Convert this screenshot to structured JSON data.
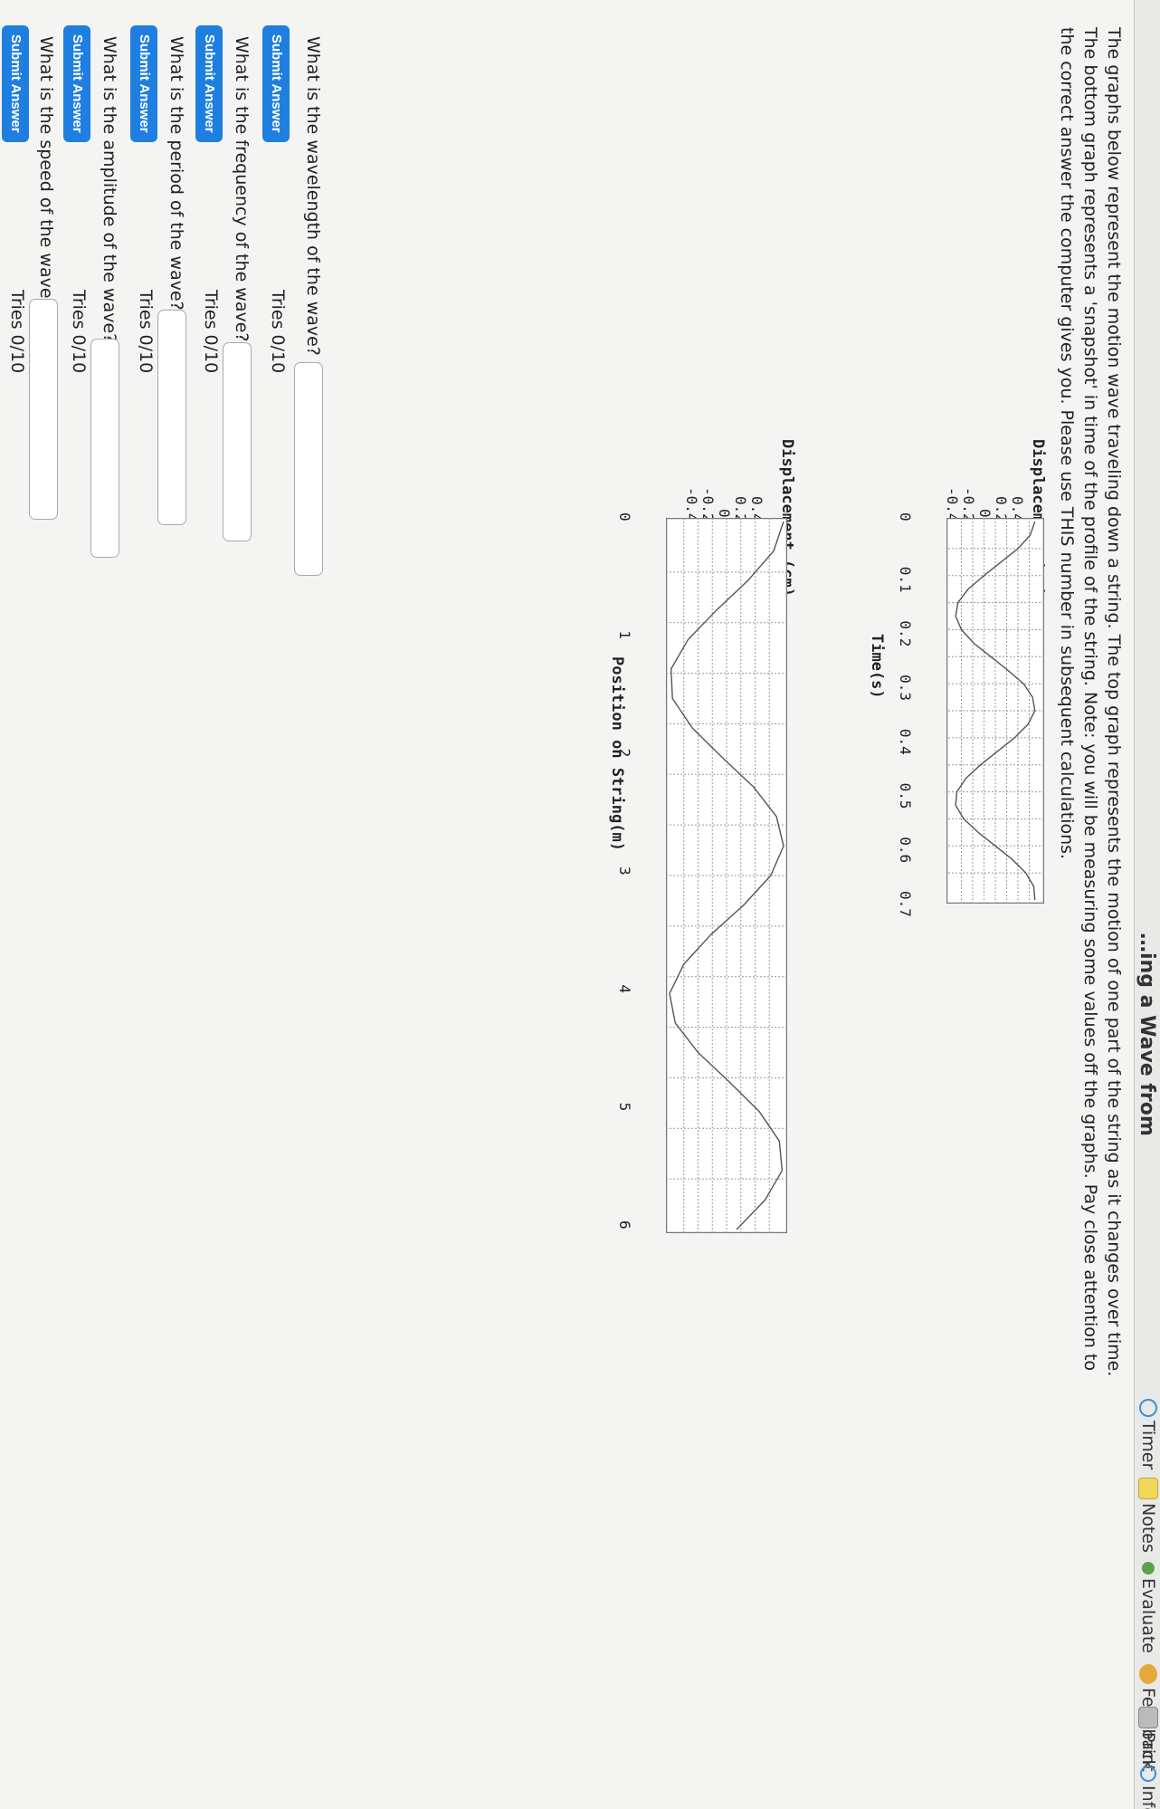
{
  "toolbar": {
    "heading": "…ing a Wave from",
    "timer": "Timer",
    "notes": "Notes",
    "evaluate": "Evaluate",
    "feedback": "Feedback",
    "print": "Print",
    "info": "Info"
  },
  "intro": {
    "line1": "The graphs below represent the motion wave traveling down a string. The top graph represents the motion of one part of the string as it changes over time.",
    "line2": "The bottom graph represents a 'snapshot' in time of the profile of the string. Note: you will be measuring some values off the graphs. Pay close attention to",
    "line3": "the correct answer the computer gives you. Please use THIS number in subsequent calculations."
  },
  "top_graph": {
    "ylabel": "Displacement (cm)",
    "xlabel": "Time(s)",
    "yticks": [
      "0.4",
      "0.2",
      "0",
      "-0.2",
      "-0.4"
    ],
    "xticks": [
      "0",
      "0.1",
      "0.2",
      "0.3",
      "0.4",
      "0.5",
      "0.6",
      "0.7"
    ]
  },
  "bottom_graph": {
    "ylabel": "Displacement (cm)",
    "xlabel": "Position on String(m)",
    "yticks": [
      "0.4",
      "0.2",
      "0",
      "-0.2",
      "-0.4"
    ],
    "xticks": [
      "0",
      "1",
      "2",
      "3",
      "4",
      "5",
      "6"
    ]
  },
  "chart_data": [
    {
      "type": "line",
      "xlabel": "Time(s)",
      "ylabel": "Displacement (cm)",
      "xlim": [
        0,
        0.7
      ],
      "ylim": [
        -0.4,
        0.4
      ],
      "grid": true,
      "x": [
        0,
        0.025,
        0.05,
        0.075,
        0.1,
        0.125,
        0.15,
        0.175,
        0.2,
        0.225,
        0.25,
        0.275,
        0.3,
        0.325,
        0.35,
        0.375,
        0.4,
        0.425,
        0.45,
        0.475,
        0.5,
        0.525,
        0.55,
        0.575,
        0.6,
        0.625,
        0.65,
        0.675,
        0.7
      ],
      "y": [
        0.35,
        0.31,
        0.2,
        0.05,
        -0.1,
        -0.24,
        -0.33,
        -0.35,
        -0.3,
        -0.19,
        -0.04,
        0.11,
        0.25,
        0.33,
        0.35,
        0.29,
        0.17,
        0.02,
        -0.13,
        -0.26,
        -0.34,
        -0.35,
        -0.28,
        -0.15,
        0.0,
        0.15,
        0.27,
        0.34,
        0.35
      ]
    },
    {
      "type": "line",
      "xlabel": "Position on String(m)",
      "ylabel": "Displacement (cm)",
      "xlim": [
        0,
        6
      ],
      "ylim": [
        -0.4,
        0.4
      ],
      "grid": true,
      "x": [
        0,
        0.25,
        0.5,
        0.75,
        1.0,
        1.25,
        1.5,
        1.75,
        2.0,
        2.25,
        2.5,
        2.75,
        3.0,
        3.25,
        3.5,
        3.75,
        4.0,
        4.25,
        4.5,
        4.75,
        5.0,
        5.25,
        5.5,
        5.75,
        6.0
      ],
      "y": [
        0.4,
        0.33,
        0.15,
        -0.07,
        -0.27,
        -0.39,
        -0.38,
        -0.24,
        -0.03,
        0.19,
        0.35,
        0.4,
        0.31,
        0.12,
        -0.11,
        -0.3,
        -0.4,
        -0.36,
        -0.2,
        0.02,
        0.23,
        0.37,
        0.39,
        0.27,
        0.07
      ]
    }
  ],
  "questions": [
    {
      "text": "What is the wavelength of the wave?",
      "submit": "Submit Answer",
      "tries": "Tries 0/10"
    },
    {
      "text": "What is the frequency of the wave?",
      "submit": "Submit Answer",
      "tries": "Tries 0/10"
    },
    {
      "text": "What is the period of the wave?",
      "submit": "Submit Answer",
      "tries": "Tries 0/10"
    },
    {
      "text": "What is the amplitude of the wave?",
      "submit": "Submit Answer",
      "tries": "Tries 0/10"
    },
    {
      "text": "What is the speed of the wave?",
      "submit": "Submit Answer",
      "tries": "Tries 0/10"
    }
  ]
}
